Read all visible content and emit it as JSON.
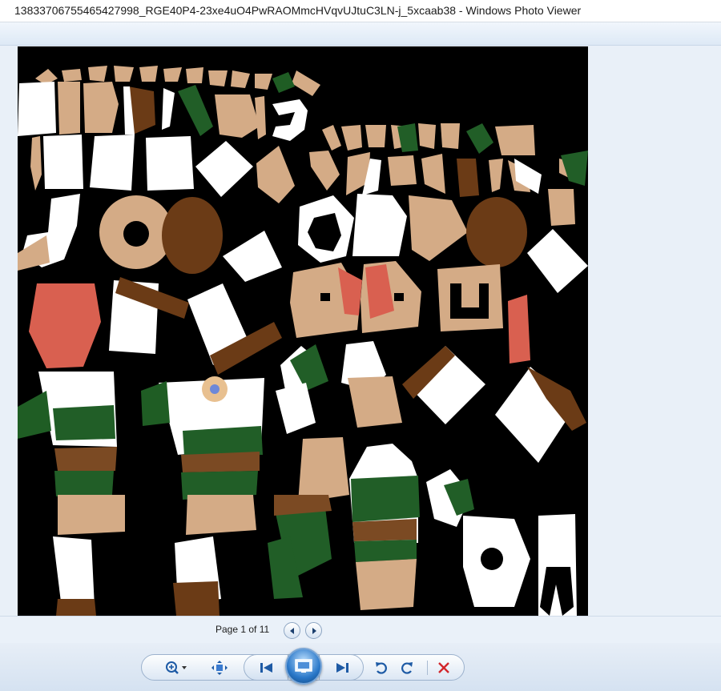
{
  "window": {
    "title": "13833706755465427998_RGE40P4-23xe4uO4PwRAOMmcHVqvUJtuC3LN-j_5xcaab38 - Windows Photo Viewer"
  },
  "image": {
    "description_icon": "texture-atlas-image"
  },
  "pager": {
    "label": "Page 1 of 11"
  },
  "colors": {
    "accent": "#2a78c9",
    "delete": "#d2262b",
    "viewer_bg": "#e9f0f8"
  },
  "toolbar": {
    "icons": [
      "zoom-icon",
      "fit-window-icon",
      "previous-icon",
      "slideshow-icon",
      "next-icon",
      "rotate-counterclockwise-icon",
      "rotate-clockwise-icon",
      "delete-icon"
    ]
  }
}
